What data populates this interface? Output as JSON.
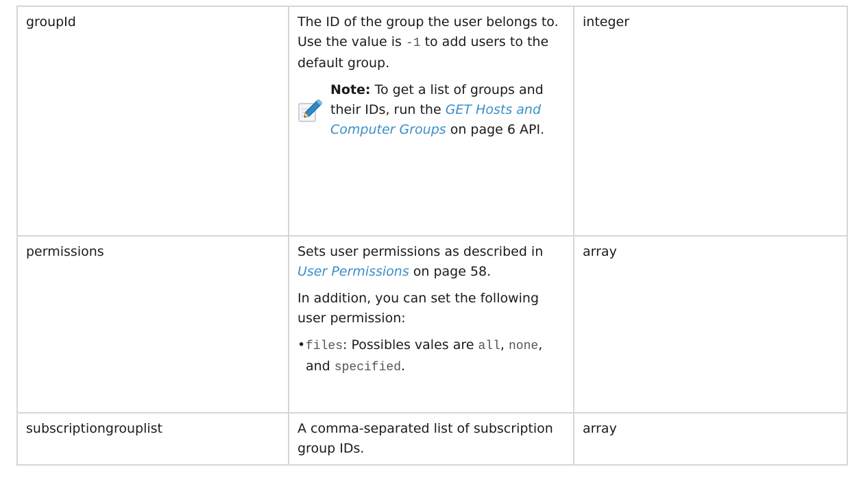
{
  "rows": [
    {
      "name": "groupId",
      "description": {
        "line1_before": "The ID of the group the user belongs to. Use the value is ",
        "code": "-1",
        "line1_after": " to add users to the default group.",
        "note": {
          "label": "Note:",
          "text_before": "To get a list of groups and their IDs, run the ",
          "link_text": "GET Hosts and Computer Groups",
          "text_after": " on page 6 API."
        }
      },
      "type": "integer"
    },
    {
      "name": "permissions",
      "description": {
        "p1_before": "Sets user permissions as described in ",
        "p1_link": "User Permissions",
        "p1_after": " on page 58.",
        "p2": "In addition, you can set the following user permission:",
        "bullet": {
          "code": "files",
          "text_before": ": Possibles vales are ",
          "code_all": "all",
          "sep1": ", ",
          "code_none": "none",
          "sep2": ", and ",
          "code_specified": "specified",
          "end": "."
        }
      },
      "type": "array"
    },
    {
      "name": "subscriptiongrouplist",
      "description": {
        "text": "A comma-separated list of subscription group IDs."
      },
      "type": "array"
    }
  ],
  "icons": {
    "note": "pencil-icon"
  },
  "colors": {
    "link": "#3a8fc7",
    "border": "#d6d6d6"
  }
}
